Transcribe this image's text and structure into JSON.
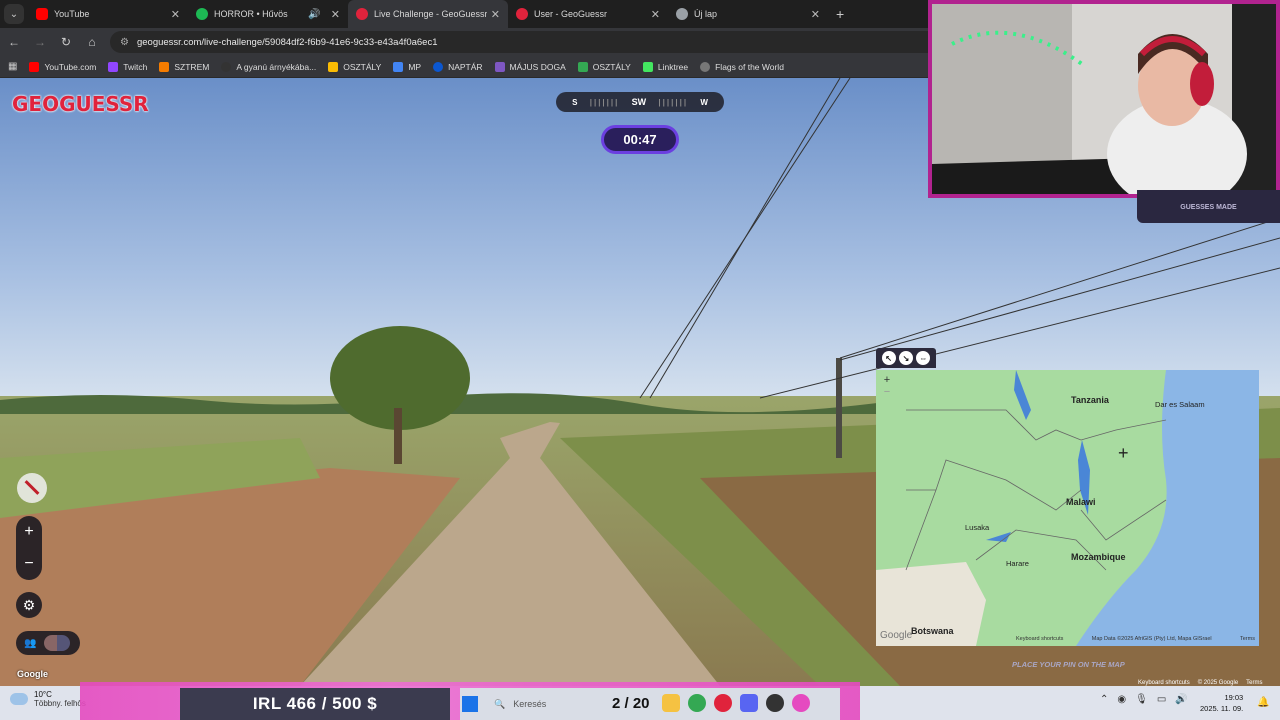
{
  "browser": {
    "tabs": [
      {
        "label": "YouTube",
        "color": "#ff0000"
      },
      {
        "label": "HORROR • Hűvös",
        "color": "#1db954"
      },
      {
        "label": "Live Challenge - GeoGuessr",
        "color": "#e0233c"
      },
      {
        "label": "User - GeoGuessr",
        "color": "#e0233c"
      },
      {
        "label": "Új lap",
        "color": "#9aa0a6"
      }
    ],
    "url": "geoguessr.com/live-challenge/59084df2-f6b9-41e6-9c33-e43a4f0a6ec1",
    "bookmarks": [
      {
        "label": "YouTube.com",
        "color": "#ff0000"
      },
      {
        "label": "Twitch",
        "color": "#9146ff"
      },
      {
        "label": "SZTREM",
        "color": "#f57c00"
      },
      {
        "label": "A gyanú árnyékába...",
        "color": "#333333"
      },
      {
        "label": "OSZTÁLY",
        "color": "#fbbc04"
      },
      {
        "label": "MP",
        "color": "#4285f4"
      },
      {
        "label": "NAPTÁR",
        "color": "#0b57d0"
      },
      {
        "label": "MÁJUS DOGA",
        "color": "#7e57c2"
      },
      {
        "label": "OSZTÁLY",
        "color": "#34a853"
      },
      {
        "label": "Linktree",
        "color": "#43e660"
      },
      {
        "label": "Flags of the World",
        "color": "#777777"
      }
    ]
  },
  "game": {
    "logo": "GEOGUESSR",
    "compass_left": "S",
    "compass_center": "SW",
    "compass_right": "W",
    "timer": "00:47",
    "google": "Google",
    "guesses_label": "GUESSES MADE",
    "place_pin": "PLACE YOUR PIN ON THE MAP",
    "keyboard_shortcuts": "Keyboard shortcuts",
    "copyright": "© 2025 Google",
    "terms": "Terms"
  },
  "map": {
    "labels": {
      "tanzania": "Tanzania",
      "dar": "Dar es Salaam",
      "malawi": "Malawi",
      "lusaka": "Lusaka",
      "mozambique": "Mozambique",
      "harare": "Harare",
      "botswana": "Botswana",
      "google": "Google"
    },
    "attribution": {
      "shortcuts": "Keyboard shortcuts",
      "data": "Map Data ©2025 AfriGIS (Pty) Ltd, Mapa GISrael",
      "terms": "Terms"
    }
  },
  "overlay": {
    "score": "IRL  466 / 500 $",
    "round": "2 / 20"
  },
  "taskbar": {
    "temp": "10°C",
    "weather": "Többny. felhős",
    "search_placeholder": "Keresés",
    "time": "19:03",
    "date": "2025. 11. 09."
  }
}
